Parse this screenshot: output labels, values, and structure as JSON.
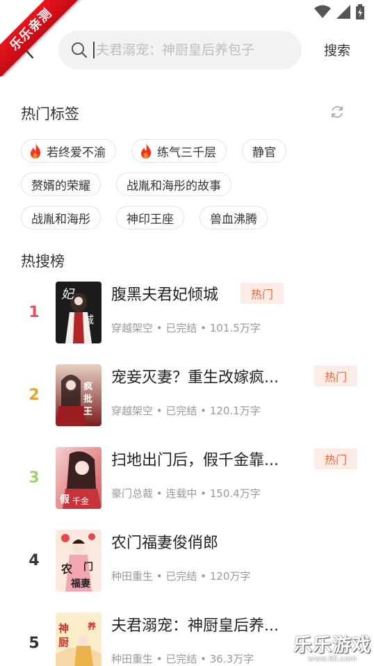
{
  "ribbon": {
    "text": "乐乐亲测"
  },
  "header": {
    "search_placeholder": "夫君溺宠：神厨皇后养包子",
    "search_button": "搜索"
  },
  "hot_tags": {
    "title": "热门标签",
    "rows": [
      [
        {
          "label": "若终爱不渝",
          "hot": true
        },
        {
          "label": "练气三千层",
          "hot": true
        },
        {
          "label": "静官",
          "hot": false
        }
      ],
      [
        {
          "label": "赘婿的荣耀",
          "hot": false
        },
        {
          "label": "战胤和海彤的故事",
          "hot": false
        }
      ],
      [
        {
          "label": "战胤和海彤",
          "hot": false
        },
        {
          "label": "神印王座",
          "hot": false
        },
        {
          "label": "兽血沸腾",
          "hot": false
        }
      ]
    ]
  },
  "hot_search": {
    "title": "热搜榜",
    "items": [
      {
        "rank": "1",
        "title": "腹黑夫君妃倾城",
        "meta": "穿越架空 • 已完结 • 101.5万字",
        "badge": "热门",
        "rank_color": "#e0505a"
      },
      {
        "rank": "2",
        "title": "宠妾灭妻？重生改嫁疯...",
        "meta": "穿越架空 • 已完结 • 120.1万字",
        "badge": "热门",
        "rank_color": "#f0a12a"
      },
      {
        "rank": "3",
        "title": "扫地出门后，假千金靠...",
        "meta": "豪门总裁 • 连载中 • 150.4万字",
        "badge": "热门",
        "rank_color": "#9fd36a"
      },
      {
        "rank": "4",
        "title": "农门福妻俊俏郎",
        "meta": "种田重生 • 已完结 • 120万字",
        "badge": "",
        "rank_color": "#333333"
      },
      {
        "rank": "5",
        "title": "夫君溺宠：神厨皇后养...",
        "meta": "种田重生 • 已完结 • 36.3万字",
        "badge": "",
        "rank_color": "#333333"
      }
    ]
  },
  "watermark": {
    "big": "乐乐游戏",
    "small": "www.6ll.com"
  }
}
